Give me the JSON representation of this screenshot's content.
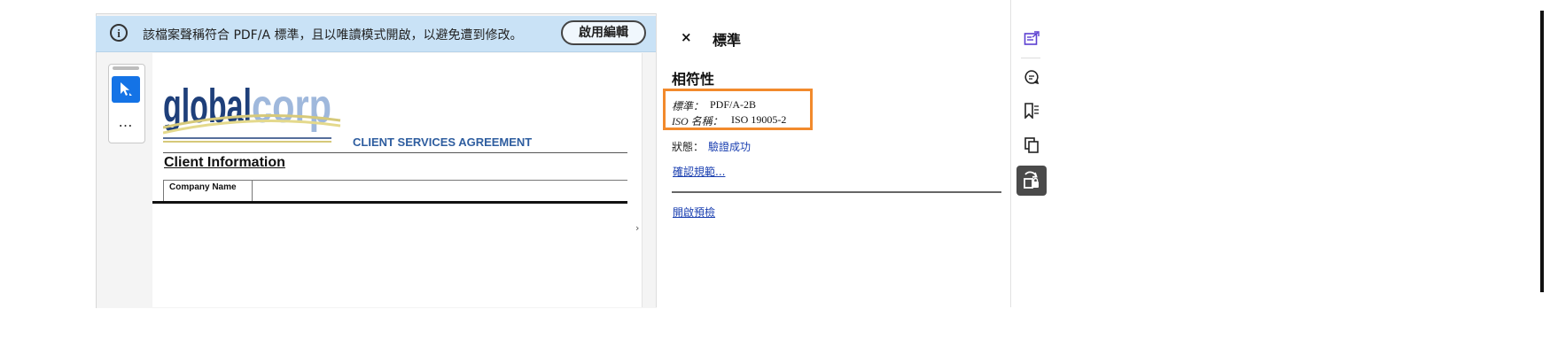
{
  "info_bar": {
    "message": "該檔案聲稱符合 PDF/A 標準，且以唯讀模式開啟，以避免遭到修改。",
    "enable_edit_label": "啟用編輯"
  },
  "toolbar": {
    "more_label": "…"
  },
  "document": {
    "logo_text": "globalcorp",
    "agreement_title": "CLIENT SERVICES AGREEMENT",
    "client_info_heading": "Client Information",
    "company_name_label": "Company Name"
  },
  "panel": {
    "close_label": "×",
    "title": "標準",
    "section_title": "相符性",
    "standard_label": "標準：",
    "standard_value": "PDF/A-2B",
    "iso_label": "ISO 名稱：",
    "iso_value": "ISO 19005-2",
    "status_label": "狀態：",
    "status_value": "驗證成功",
    "verify_link": "確認規範...",
    "preflight_link": "開啟預檢"
  },
  "colors": {
    "info_bar_bg": "#c9e2f6",
    "accent_blue": "#1473e6",
    "highlight_orange": "#f28a2c",
    "link_blue": "#1a3fb0",
    "rail_icon_purple": "#5b3fd1"
  },
  "rail": {
    "icons": [
      "edit-pdf-icon",
      "comment-icon",
      "bookmark-icon",
      "pages-icon",
      "standards-icon"
    ]
  }
}
